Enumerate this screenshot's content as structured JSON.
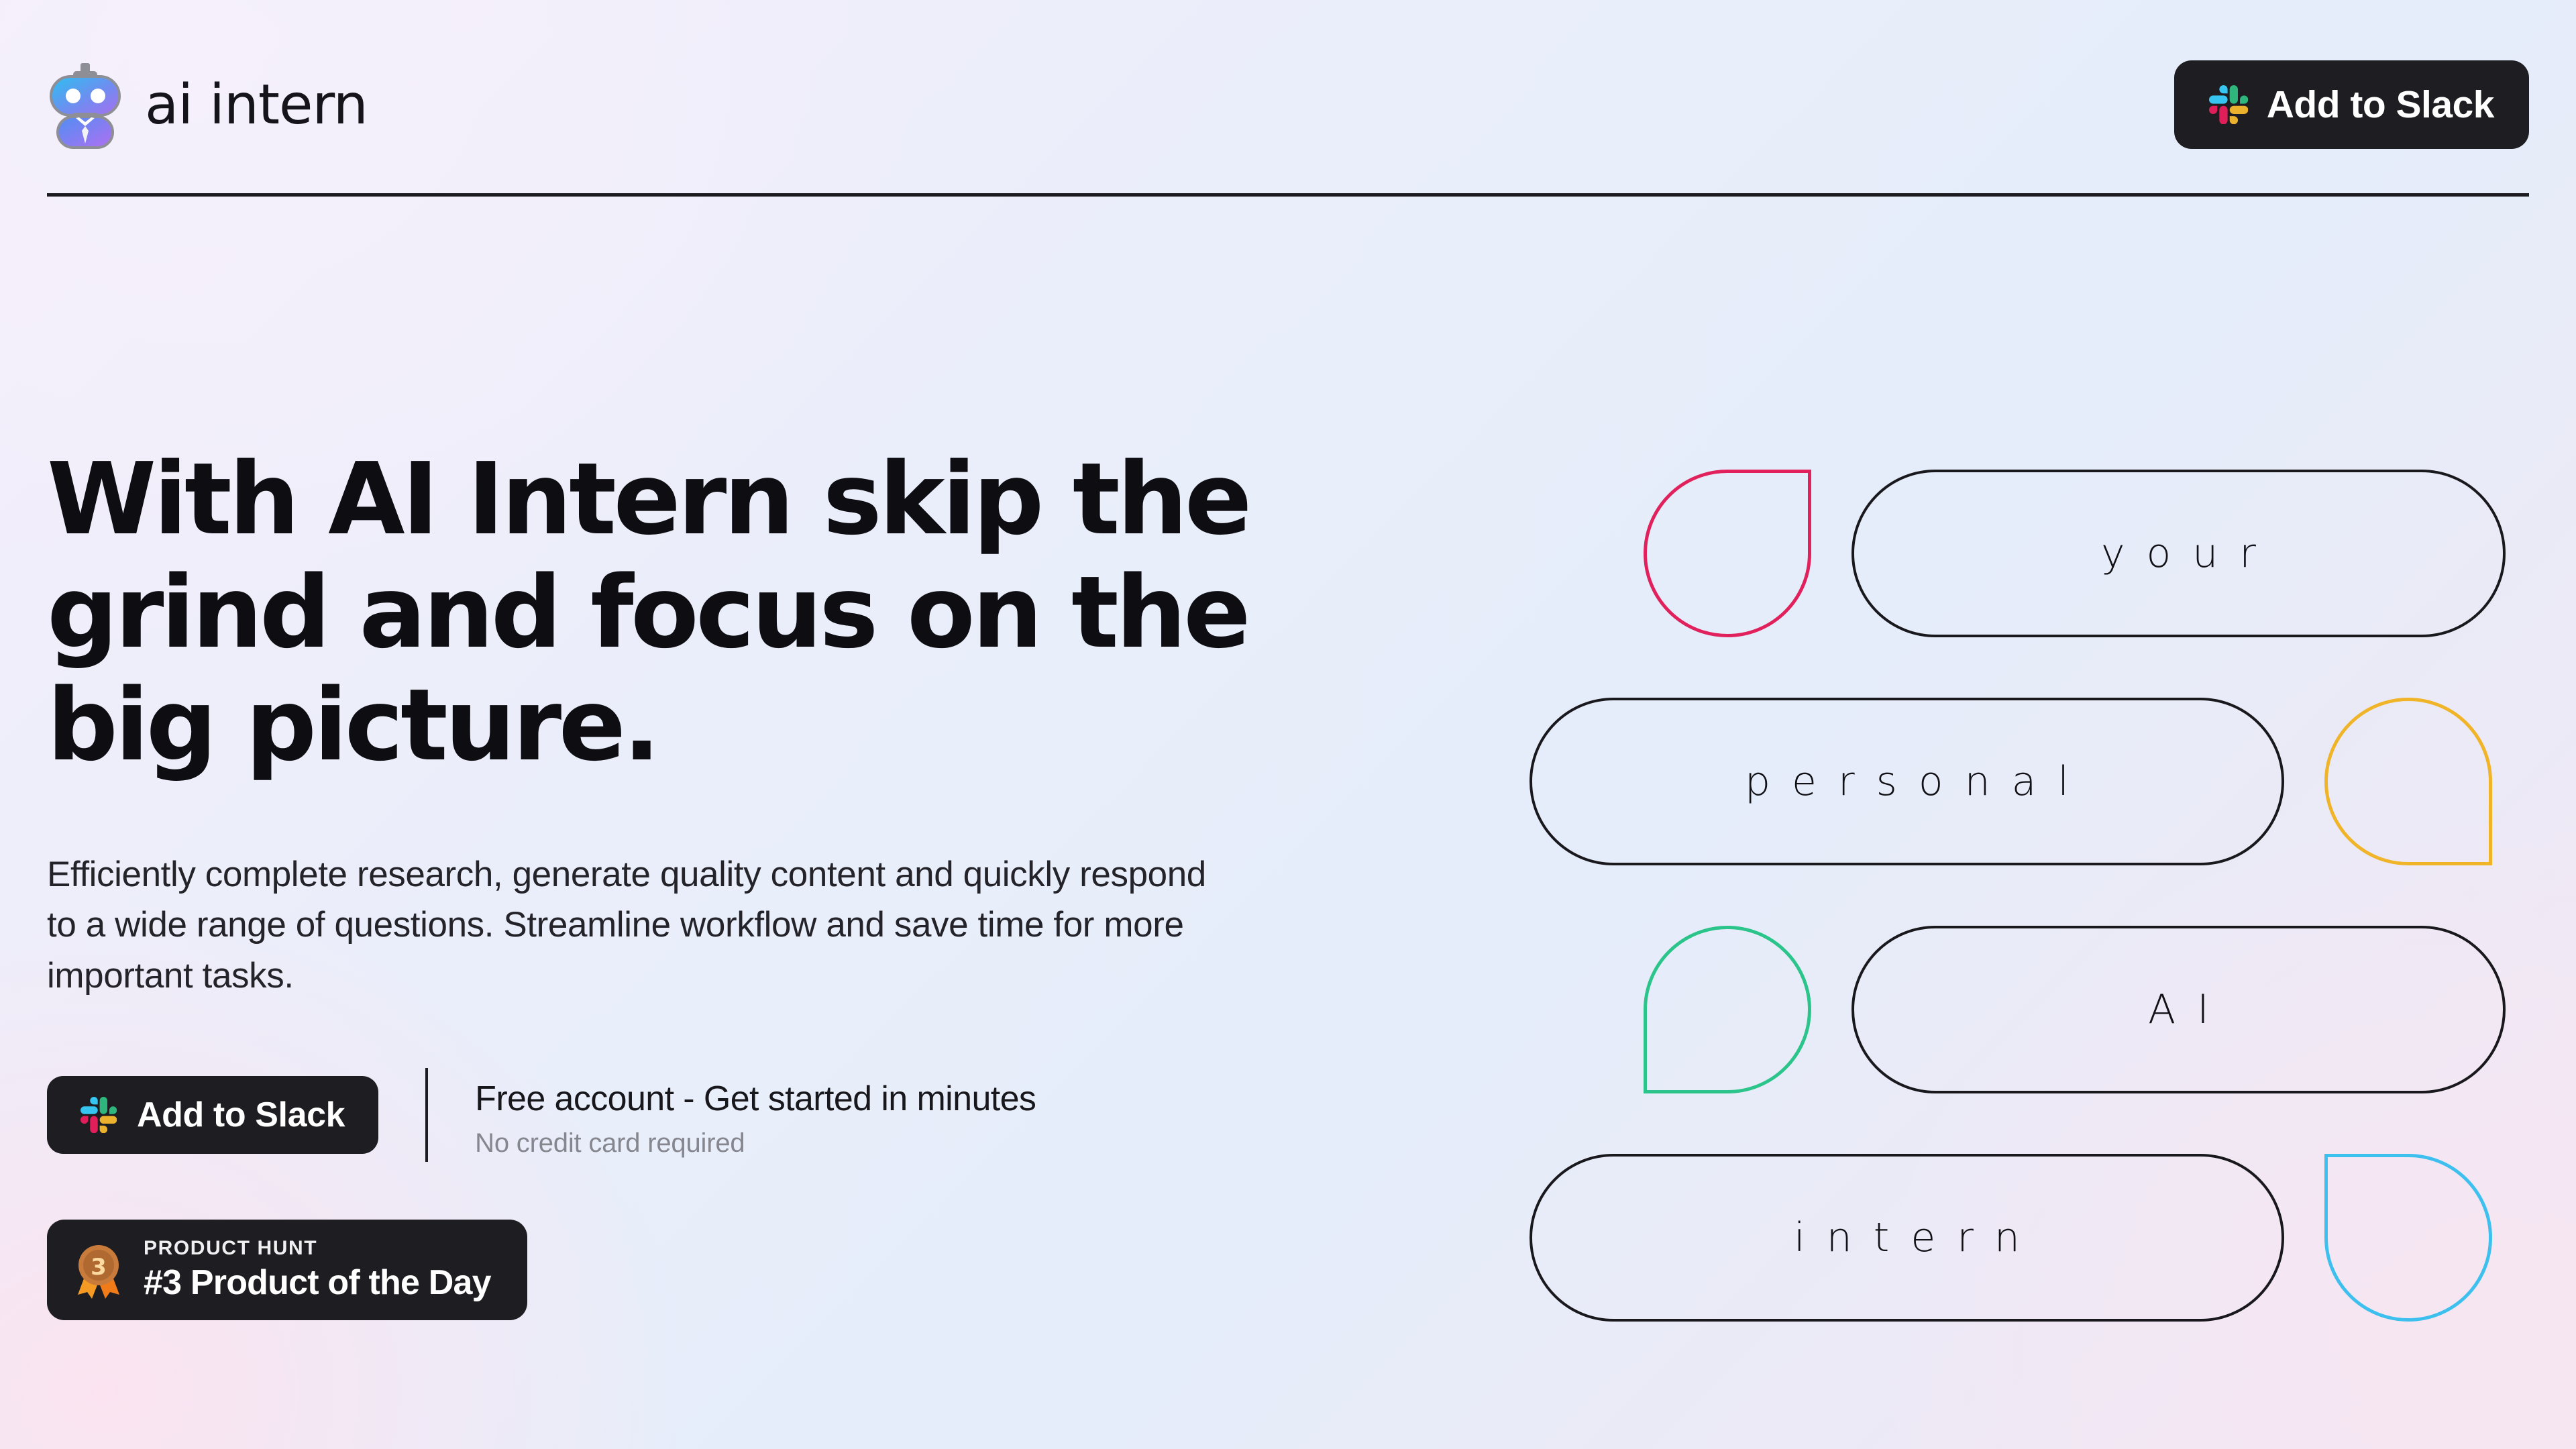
{
  "header": {
    "brand_name": "ai intern",
    "logo_icon": "robot-mascot-icon",
    "cta": {
      "label": "Add to Slack",
      "icon": "slack-icon"
    }
  },
  "hero": {
    "headline": "With AI Intern skip the grind and focus on the big picture.",
    "subcopy": "Efficiently complete research, generate quality content and quickly respond to a wide range of questions. Streamline workflow and save time for more important tasks.",
    "primary_cta": {
      "label": "Add to Slack",
      "icon": "slack-icon"
    },
    "cta_note": {
      "title": "Free account - Get started in minutes",
      "subtitle": "No credit card required"
    },
    "product_hunt": {
      "icon": "medal-3rd-place-icon",
      "eyebrow": "PRODUCT HUNT",
      "title": "#3 Product of the Day"
    }
  },
  "illustration": {
    "rows": [
      {
        "word": "your",
        "drop_color": "#e0215c",
        "drop_corner": "sharp-tr",
        "drop_side": "left"
      },
      {
        "word": "personal",
        "drop_color": "#f0b429",
        "drop_corner": "sharp-br",
        "drop_side": "right"
      },
      {
        "word": "AI",
        "drop_color": "#2bc48a",
        "drop_corner": "sharp-bl",
        "drop_side": "left"
      },
      {
        "word": "intern",
        "drop_color": "#3ec0ef",
        "drop_corner": "sharp-tl",
        "drop_side": "right"
      }
    ]
  },
  "colors": {
    "ink": "#18181d",
    "button_dark": "#1e1e22",
    "muted_text": "#86868f",
    "slack_blue": "#36C5F0",
    "slack_green": "#2EB67D",
    "slack_red": "#E01E5A",
    "slack_yellow": "#ECB22E",
    "pink": "#e0215c",
    "amber": "#f0b429",
    "green": "#2bc48a",
    "blue": "#3ec0ef"
  }
}
